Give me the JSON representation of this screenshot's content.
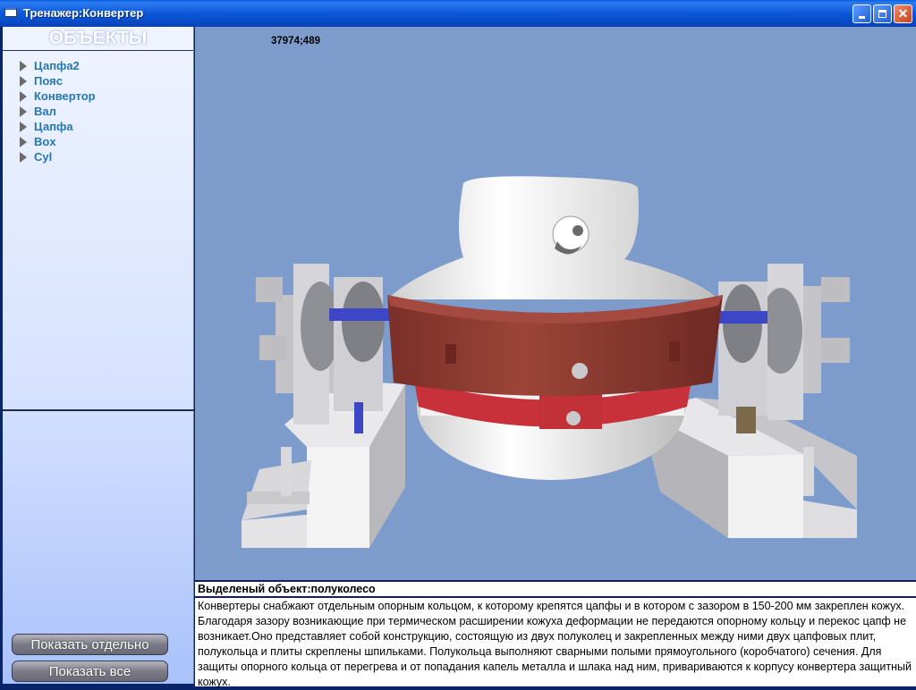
{
  "window": {
    "title": "Тренажер:Конвертер"
  },
  "sidebar": {
    "header": "ОБЪЕКТЫ",
    "items": [
      {
        "label": "Цапфа2"
      },
      {
        "label": "Пояс"
      },
      {
        "label": "Конвертор"
      },
      {
        "label": "Вал"
      },
      {
        "label": "Цапфа"
      },
      {
        "label": "Box"
      },
      {
        "label": "Cyl"
      }
    ],
    "show_selected_label": "Показать отдельно",
    "show_all_label": "Показать все"
  },
  "viewport": {
    "coords": "37974;489"
  },
  "info": {
    "selected_label": "Выделеный объект:полуколесо",
    "description": "Конвертеры снабжают отдельным опорным кольцом, к которому крепятся цапфы и в котором с зазором в 150-200 мм закреплен кожух. Благодаря зазору возникающие при термическом расширении кожуха деформации не передаются опорному кольцу и перекос цапф не возникает.Оно представляет собой конструкцию, состоящую из двух полуколец и закрепленных между ними двух цапфовых плит, полукольца и плиты скреплены шпильками. Полукольца выполняют сварными полыми прямоугольного (коробчатого) сечения. Для защиты опорного кольца от перегрева и от попадания капель металла и шлака над ним, привариваются к корпусу конвертера защитный кожух."
  },
  "colors": {
    "titlebar": "#0a5fe0",
    "viewport_bg": "#7d9ccc",
    "tree_text": "#2577b0",
    "ring": "#8b3a30",
    "vessel": "#f2f2f2"
  }
}
